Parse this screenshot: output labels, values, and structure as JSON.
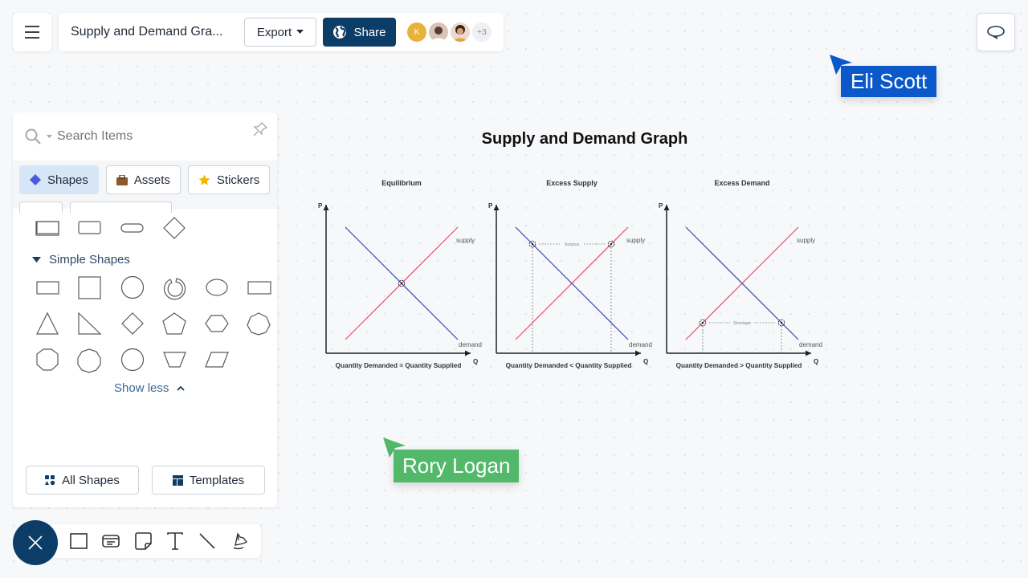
{
  "header": {
    "doc_title": "Supply and Demand Gra...",
    "export_label": "Export",
    "share_label": "Share",
    "avatar_initial": "K",
    "more_collaborators": "+3"
  },
  "panel": {
    "search_placeholder": "Search Items",
    "tabs": [
      {
        "label": "Shapes",
        "icon": "diamond-icon",
        "active": true
      },
      {
        "label": "Assets",
        "icon": "briefcase-icon",
        "active": false
      },
      {
        "label": "Stickers",
        "icon": "star-icon",
        "active": false
      }
    ],
    "section_title": "Simple Shapes",
    "show_less": "Show less",
    "all_shapes": "All Shapes",
    "templates": "Templates"
  },
  "toolbar": {
    "tools": [
      "rectangle-tool",
      "card-tool",
      "sticky-note-tool",
      "text-tool",
      "line-tool",
      "pen-tool"
    ]
  },
  "cursors": [
    {
      "name": "Eli Scott",
      "color": "#0a58ca"
    },
    {
      "name": "Rory Logan",
      "color": "#52b86a"
    }
  ],
  "canvas": {
    "title": "Supply and Demand Graph"
  },
  "chart_data": [
    {
      "type": "line",
      "title": "Equilibrium",
      "xlabel": "Q",
      "ylabel": "P",
      "caption": "Quantity Demanded = Quantity Supplied",
      "series": [
        {
          "name": "supply",
          "color": "#e0506a",
          "points": [
            [
              1,
              1
            ],
            [
              9,
              9
            ]
          ]
        },
        {
          "name": "demand",
          "color": "#3548b5",
          "points": [
            [
              1,
              9
            ],
            [
              9,
              1
            ]
          ]
        }
      ],
      "markers": [
        [
          5,
          5
        ]
      ],
      "annotation": ""
    },
    {
      "type": "line",
      "title": "Excess Supply",
      "xlabel": "Q",
      "ylabel": "P",
      "caption": "Quantity Demanded < Quantity Supplied",
      "series": [
        {
          "name": "supply",
          "color": "#e0506a",
          "points": [
            [
              1,
              1
            ],
            [
              9,
              9
            ]
          ]
        },
        {
          "name": "demand",
          "color": "#3548b5",
          "points": [
            [
              1,
              9
            ],
            [
              9,
              1
            ]
          ]
        }
      ],
      "markers": [
        [
          2.2,
          7.8
        ],
        [
          7.8,
          7.8
        ]
      ],
      "annotation": "Surplus"
    },
    {
      "type": "line",
      "title": "Excess Demand",
      "xlabel": "Q",
      "ylabel": "P",
      "caption": "Quantity Demanded > Quantity Supplied",
      "series": [
        {
          "name": "supply",
          "color": "#e0506a",
          "points": [
            [
              1,
              1
            ],
            [
              9,
              9
            ]
          ]
        },
        {
          "name": "demand",
          "color": "#3548b5",
          "points": [
            [
              1,
              9
            ],
            [
              9,
              1
            ]
          ]
        }
      ],
      "markers": [
        [
          2.2,
          2.2
        ],
        [
          7.8,
          2.2
        ]
      ],
      "annotation": "Shortage"
    }
  ]
}
